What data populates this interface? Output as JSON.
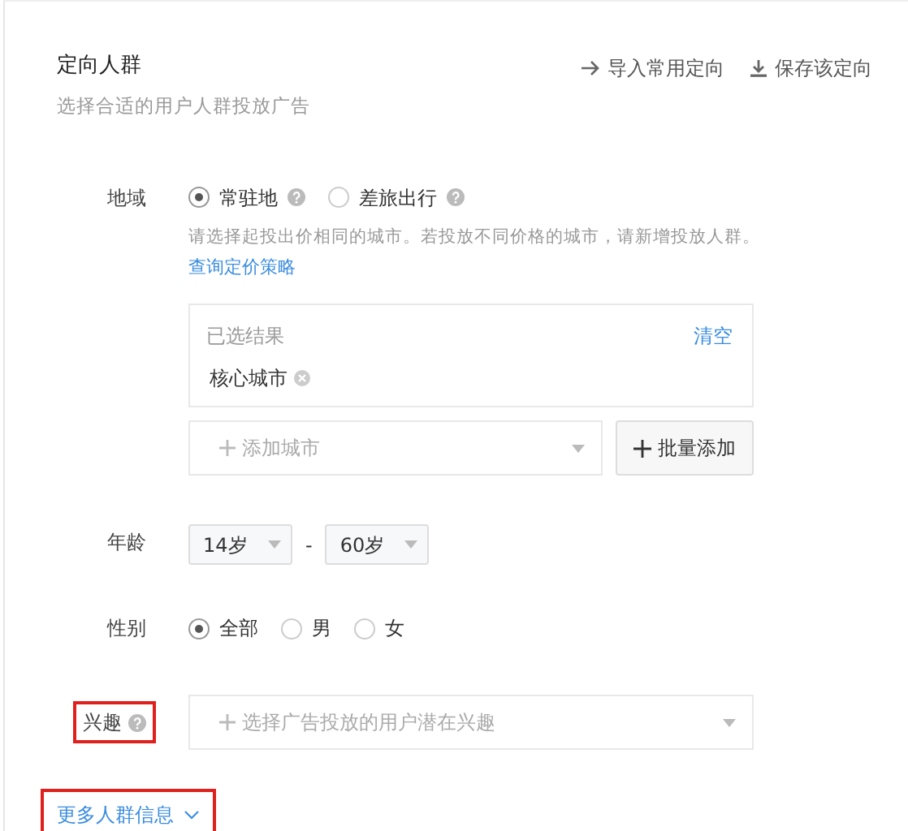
{
  "section": {
    "title": "定向人群",
    "subtitle": "选择合适的用户人群投放广告"
  },
  "actions": [
    {
      "kind": "import",
      "label": "导入常用定向"
    },
    {
      "kind": "save",
      "label": "保存该定向"
    }
  ],
  "region": {
    "label": "地域",
    "options": [
      {
        "label": "常驻地",
        "help": true,
        "selected": true
      },
      {
        "label": "差旅出行",
        "help": true,
        "selected": false
      }
    ],
    "hint": "请选择起投出价相同的城市。若投放不同价格的城市，请新增投放人群。",
    "link": "查询定价策略",
    "result": {
      "title": "已选结果",
      "clear": "清空",
      "tags": [
        "核心城市"
      ]
    },
    "add_city": {
      "placeholder": "添加城市"
    },
    "bulk_button": "批量添加"
  },
  "age": {
    "label": "年龄",
    "from": "14岁",
    "separator": "-",
    "to": "60岁"
  },
  "gender": {
    "label": "性别",
    "options": [
      {
        "label": "全部",
        "selected": true
      },
      {
        "label": "男",
        "selected": false
      },
      {
        "label": "女",
        "selected": false
      }
    ]
  },
  "interest": {
    "label": "兴趣",
    "help": true,
    "highlighted": true,
    "placeholder": "选择广告投放的用户潜在兴趣"
  },
  "more": {
    "label": "更多人群信息",
    "highlighted": true
  }
}
